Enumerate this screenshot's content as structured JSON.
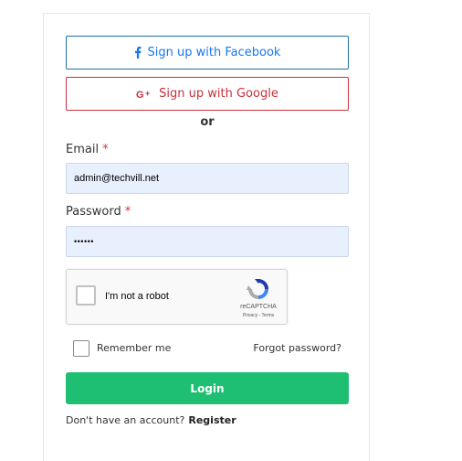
{
  "social": {
    "facebook_label": "Sign up with Facebook",
    "google_label": "Sign up with Google",
    "facebook_color": "#1877f2",
    "google_color": "#c9303c"
  },
  "divider_text": "or",
  "form": {
    "email_label": "Email",
    "email_value": "admin@techvill.net",
    "password_label": "Password",
    "password_value": "••••••",
    "required_marker": "*"
  },
  "recaptcha": {
    "label": "I'm not a robot",
    "brand": "reCAPTCHA",
    "links": "Privacy - Terms"
  },
  "remember_label": "Remember me",
  "forgot_label": "Forgot password?",
  "login_label": "Login",
  "login_color": "#1fbf73",
  "register": {
    "prompt": "Don't have an account?",
    "link_label": "Register"
  }
}
